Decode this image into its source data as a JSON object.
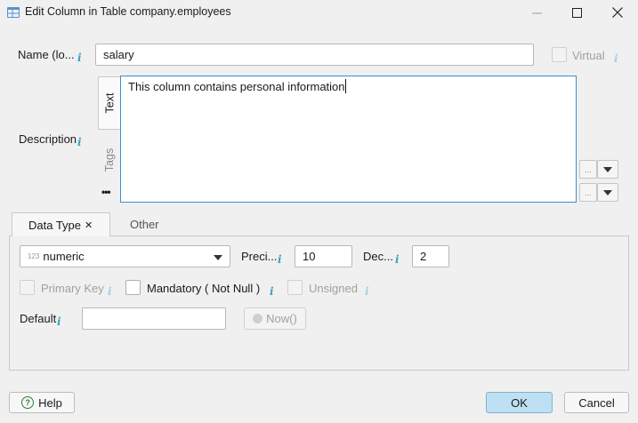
{
  "window": {
    "title": "Edit Column in Table company.employees"
  },
  "name_field": {
    "label": "Name (lo...",
    "value": "salary"
  },
  "virtual": {
    "label": "Virtual"
  },
  "description": {
    "label": "Description",
    "tabs": [
      "Text",
      "Tags"
    ],
    "more_label": "•••",
    "text": "This column contains personal information",
    "btn_dots": "...",
    "btn_arrow": "▼"
  },
  "tabs": {
    "data_type": "Data Type",
    "data_type_close": "✕",
    "other": "Other"
  },
  "data_type": {
    "type_prefix": "123",
    "type_value": "numeric",
    "precision_label": "Preci...",
    "precision_value": "10",
    "decimals_label": "Dec...",
    "decimals_value": "2",
    "primary_key_label": "Primary Key",
    "mandatory_label": "Mandatory ( Not Null )",
    "unsigned_label": "Unsigned",
    "default_label": "Default",
    "default_value": "",
    "now_label": "Now()"
  },
  "buttons": {
    "help": "Help",
    "ok": "OK",
    "cancel": "Cancel"
  },
  "icons": {
    "info": "i",
    "help_circle": "?"
  }
}
